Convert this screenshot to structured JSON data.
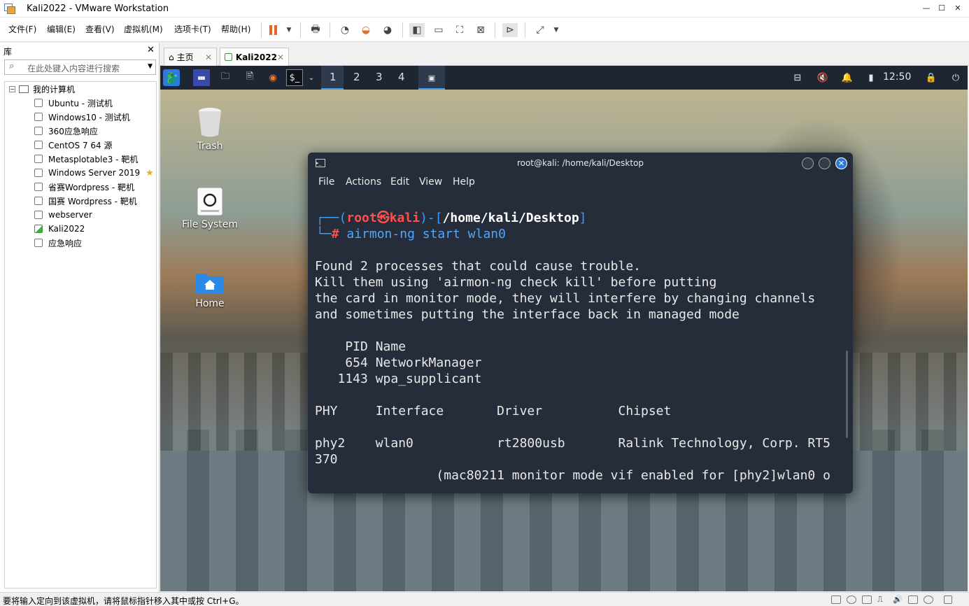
{
  "window": {
    "title": "Kali2022 - VMware Workstation"
  },
  "menu": [
    "文件(F)",
    "编辑(E)",
    "查看(V)",
    "虚拟机(M)",
    "选项卡(T)",
    "帮助(H)"
  ],
  "library": {
    "header": "库",
    "search_placeholder": "在此处键入内容进行搜索",
    "root": "我的计算机",
    "items": [
      "Ubuntu - 测试机",
      "Windows10 - 测试机",
      "360应急响应",
      "CentOS 7 64 源",
      "Metasplotable3 - 靶机",
      "Windows Server 2019",
      "省赛Wordpress - 靶机",
      "国赛 Wordpress - 靶机",
      "webserver",
      "Kali2022",
      "应急响应"
    ]
  },
  "tabs": [
    {
      "label": "主页"
    },
    {
      "label": "Kali2022"
    }
  ],
  "guest": {
    "workspaces": [
      "1",
      "2",
      "3",
      "4"
    ],
    "clock": "12:50",
    "desktop_icons": [
      "Trash",
      "File System",
      "Home"
    ]
  },
  "terminal": {
    "title": "root@kali: /home/kali/Desktop",
    "menu": [
      "File",
      "Actions",
      "Edit",
      "View",
      "Help"
    ],
    "prompt_user": "root",
    "prompt_at": "㉿",
    "prompt_host": "kali",
    "prompt_path": "/home/kali/Desktop",
    "command": "airmon-ng start wlan0",
    "output": [
      "Found 2 processes that could cause trouble.",
      "Kill them using 'airmon-ng check kill' before putting",
      "the card in monitor mode, they will interfere by changing channels",
      "and sometimes putting the interface back in managed mode",
      "",
      "    PID Name",
      "    654 NetworkManager",
      "   1143 wpa_supplicant",
      "",
      "PHY     Interface       Driver          Chipset",
      "",
      "phy2    wlan0           rt2800usb       Ralink Technology, Corp. RT5",
      "370",
      "                (mac80211 monitor mode vif enabled for [phy2]wlan0 o"
    ]
  },
  "status": "要将输入定向到该虚拟机，请将鼠标指针移入其中或按 Ctrl+G。",
  "colors": {
    "prompt_red": "#ff4f4f",
    "prompt_blue": "#3e9cf2",
    "cmd_blue": "#4ea7ff",
    "term_bg": "#262d3a",
    "panel_bg": "#1f2633",
    "close_blue": "#2e79d6"
  }
}
